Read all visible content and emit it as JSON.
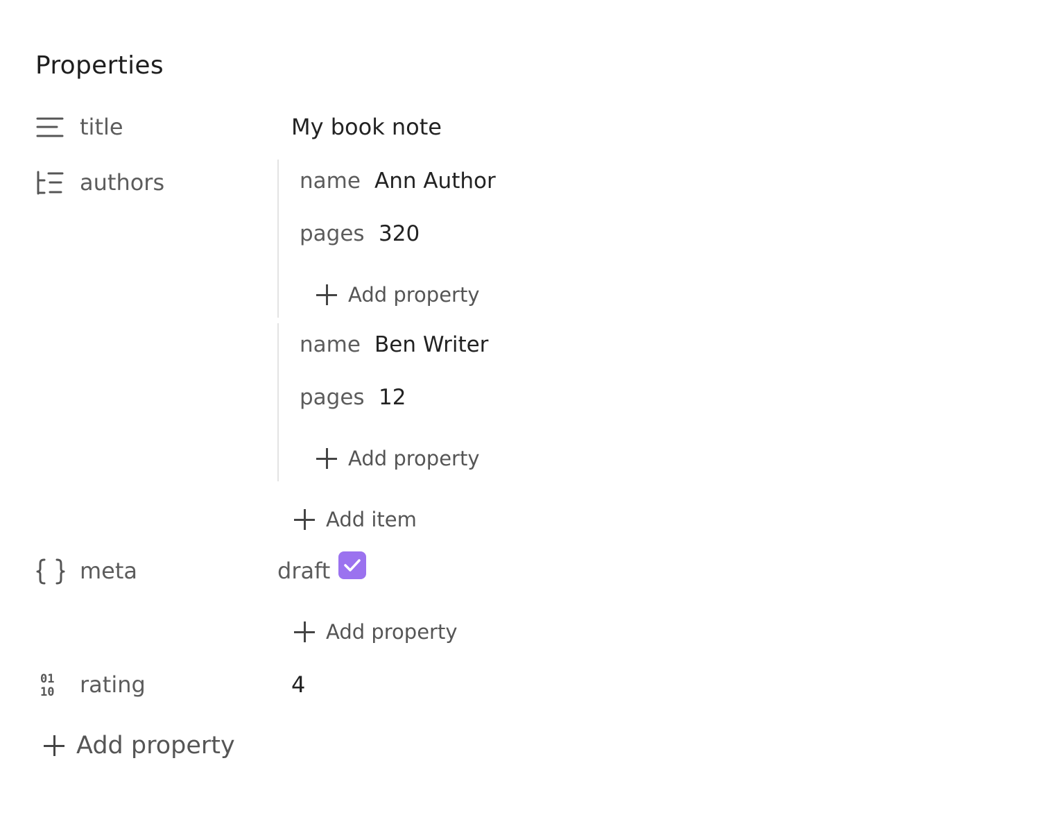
{
  "panel": {
    "heading": "Properties",
    "properties": [
      {
        "key": "title",
        "icon": "text-lines-icon",
        "value": "My book note"
      },
      {
        "key": "authors",
        "icon": "list-tree-icon",
        "items": [
          {
            "fields": [
              {
                "key": "name",
                "value": "Ann Author"
              },
              {
                "key": "pages",
                "value": "320"
              }
            ],
            "add_property_label": "Add property"
          },
          {
            "fields": [
              {
                "key": "name",
                "value": "Ben Writer"
              },
              {
                "key": "pages",
                "value": "12"
              }
            ],
            "add_property_label": "Add property"
          }
        ],
        "add_item_label": "Add item"
      },
      {
        "key": "meta",
        "icon": "braces-icon",
        "fields": [
          {
            "key": "draft",
            "checked": true
          }
        ],
        "add_property_label": "Add property"
      },
      {
        "key": "rating",
        "icon": "binary-number-icon",
        "value": "4"
      }
    ],
    "add_property_label": "Add property"
  },
  "colors": {
    "checkbox_accent": "#9b72ef",
    "key_text": "#5c5c5c",
    "value_text": "#222222",
    "divider": "#e3e3e3"
  }
}
